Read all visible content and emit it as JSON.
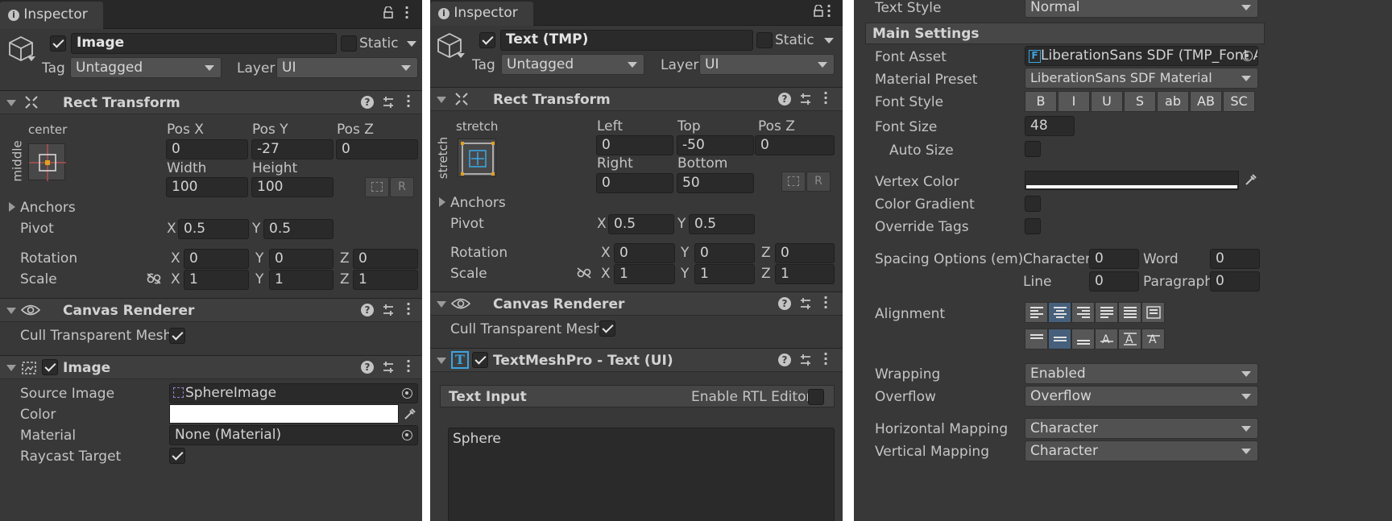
{
  "panel1": {
    "tab_label": "Inspector",
    "object_name": "Image",
    "static_label": "Static",
    "tag_label": "Tag",
    "tag_value": "Untagged",
    "layer_label": "Layer",
    "layer_value": "UI",
    "rect_transform": {
      "title": "Rect Transform",
      "anchor_h": "center",
      "anchor_v": "middle",
      "posx_label": "Pos X",
      "posy_label": "Pos Y",
      "posz_label": "Pos Z",
      "posx": "0",
      "posy": "-27",
      "posz": "0",
      "width_label": "Width",
      "height_label": "Height",
      "width": "100",
      "height": "100",
      "r_button": "R",
      "anchors_label": "Anchors",
      "pivot_label": "Pivot",
      "pivot_x_label": "X",
      "pivot_x": "0.5",
      "pivot_y_label": "Y",
      "pivot_y": "0.5",
      "rotation_label": "Rotation",
      "rot_x": "0",
      "rot_y": "0",
      "rot_z": "0",
      "scale_label": "Scale",
      "scale_x": "1",
      "scale_y": "1",
      "scale_z": "1",
      "x": "X",
      "y": "Y",
      "z": "Z"
    },
    "canvas_renderer": {
      "title": "Canvas Renderer",
      "cull_label": "Cull Transparent Mesh"
    },
    "image": {
      "title": "Image",
      "source_label": "Source Image",
      "source_value": "SphereImage",
      "color_label": "Color",
      "color_value": "#ffffff",
      "material_label": "Material",
      "material_value": "None (Material)",
      "raycast_label": "Raycast Target"
    }
  },
  "panel2": {
    "tab_label": "Inspector",
    "object_name": "Text (TMP)",
    "static_label": "Static",
    "tag_label": "Tag",
    "tag_value": "Untagged",
    "layer_label": "Layer",
    "layer_value": "UI",
    "rect_transform": {
      "title": "Rect Transform",
      "anchor_h": "stretch",
      "anchor_v": "stretch",
      "left_label": "Left",
      "top_label": "Top",
      "posz_label": "Pos Z",
      "left": "0",
      "top": "-50",
      "posz": "0",
      "right_label": "Right",
      "bottom_label": "Bottom",
      "right": "0",
      "bottom": "50",
      "r_button": "R",
      "anchors_label": "Anchors",
      "pivot_label": "Pivot",
      "pivot_x": "0.5",
      "pivot_y": "0.5",
      "rotation_label": "Rotation",
      "rot_x": "0",
      "rot_y": "0",
      "rot_z": "0",
      "scale_label": "Scale",
      "scale_x": "1",
      "scale_y": "1",
      "scale_z": "1",
      "x": "X",
      "y": "Y",
      "z": "Z"
    },
    "canvas_renderer": {
      "title": "Canvas Renderer",
      "cull_label": "Cull Transparent Mesh"
    },
    "tmp": {
      "title": "TextMeshPro - Text (UI)",
      "icon_letter": "T",
      "text_input_label": "Text Input",
      "rtl_label": "Enable RTL Editor",
      "text_value": "Sphere"
    }
  },
  "panel3": {
    "text_style_label": "Text Style",
    "text_style_value": "Normal",
    "main_settings": "Main Settings",
    "font_asset_label": "Font Asset",
    "font_asset_value": "LiberationSans SDF (TMP_Font A",
    "font_asset_icon": "F",
    "material_preset_label": "Material Preset",
    "material_preset_value": "LiberationSans SDF Material",
    "font_style_label": "Font Style",
    "font_style_buttons": [
      "B",
      "I",
      "U",
      "S",
      "ab",
      "AB",
      "SC"
    ],
    "font_size_label": "Font Size",
    "font_size_value": "48",
    "auto_size_label": "Auto Size",
    "vertex_color_label": "Vertex Color",
    "vertex_color_value": "#ffffff",
    "color_gradient_label": "Color Gradient",
    "override_tags_label": "Override Tags",
    "spacing_label": "Spacing Options (em)",
    "character_label": "Character",
    "character_value": "0",
    "word_label": "Word",
    "word_value": "0",
    "line_label": "Line",
    "line_value": "0",
    "paragraph_label": "Paragraph",
    "paragraph_value": "0",
    "alignment_label": "Alignment",
    "wrapping_label": "Wrapping",
    "wrapping_value": "Enabled",
    "overflow_label": "Overflow",
    "overflow_value": "Overflow",
    "hmapping_label": "Horizontal Mapping",
    "hmapping_value": "Character",
    "vmapping_label": "Vertical Mapping",
    "vmapping_value": "Character"
  },
  "icons": {
    "lock": "lock-icon",
    "menu": "kebab-menu-icon",
    "help": "help-icon",
    "preset": "preset-icon",
    "cube": "gameobject-cube-icon",
    "eye": "eye-icon",
    "link": "constrain-proportions-icon",
    "picker": "eyedropper-icon",
    "target": "object-picker-icon"
  }
}
